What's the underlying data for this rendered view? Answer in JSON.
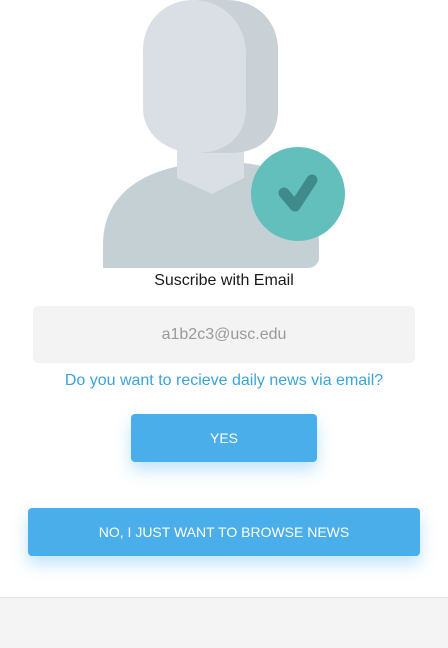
{
  "illustration": {
    "person_icon": "user-silhouette-icon",
    "badge_icon": "checkmark-icon",
    "colors": {
      "person_light": "#d9dfe4",
      "person_shade": "#c9d1d6",
      "body": "#c5d0d5",
      "badge": "#63bfbb",
      "check": "#3f8b8c"
    }
  },
  "form": {
    "title": "Suscribe with Email",
    "email_value": "a1b2c3@usc.edu",
    "question": "Do you want to recieve daily news via email?",
    "yes_label": "YES",
    "no_label": "NO, I JUST WANT TO BROWSE NEWS"
  },
  "colors": {
    "accent": "#4aaeea",
    "link_text": "#3aa4d8",
    "field_bg": "#f3f3f3",
    "footer_bg": "#f4f4f4"
  }
}
